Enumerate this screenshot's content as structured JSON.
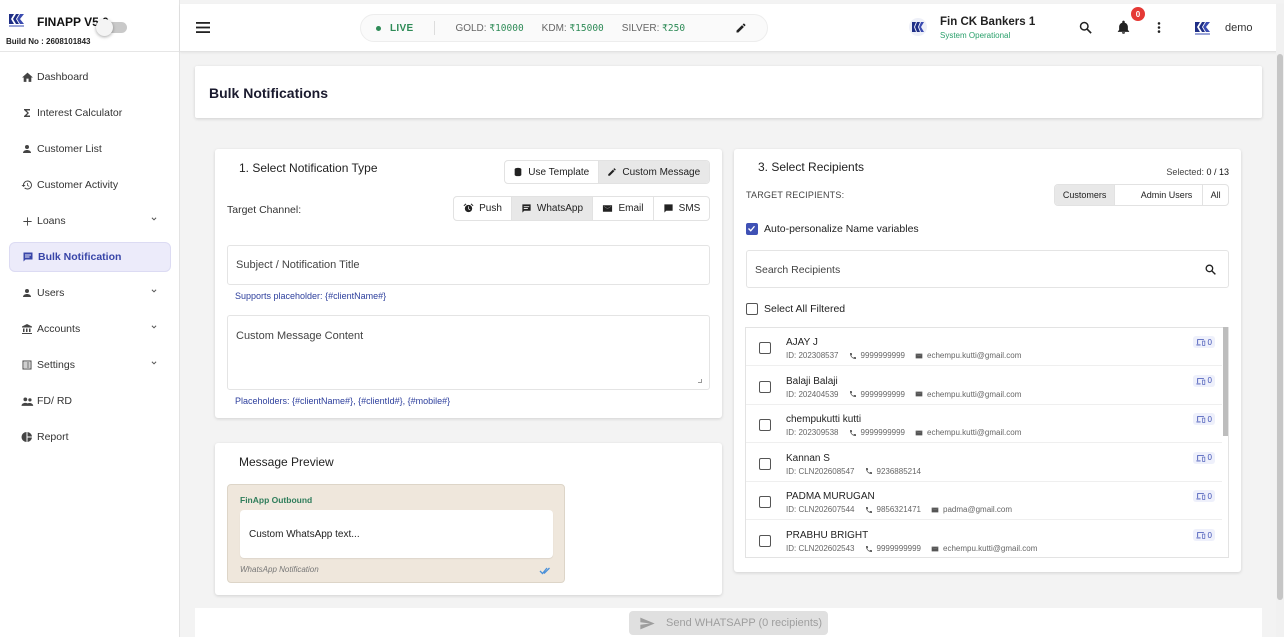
{
  "sidebar": {
    "app_name": "FINAPP V5.0",
    "build": "Build No : 2608101843",
    "items": [
      {
        "label": "Dashboard",
        "icon": "home-icon"
      },
      {
        "label": "Interest Calculator",
        "icon": "sigma-icon"
      },
      {
        "label": "Customer List",
        "icon": "person-icon"
      },
      {
        "label": "Customer Activity",
        "icon": "history-icon"
      },
      {
        "label": "Loans",
        "icon": "plus-icon"
      },
      {
        "label": "Bulk Notification",
        "icon": "message-icon"
      },
      {
        "label": "Users",
        "icon": "person-icon"
      },
      {
        "label": "Accounts",
        "icon": "bank-icon"
      },
      {
        "label": "Settings",
        "icon": "list-icon"
      },
      {
        "label": "FD/ RD",
        "icon": "group-icon"
      },
      {
        "label": "Report",
        "icon": "pie-chart-icon"
      }
    ],
    "active_index": 5
  },
  "topbar": {
    "live_label": "LIVE",
    "rates": [
      {
        "name": "GOLD:",
        "value": "₹10000"
      },
      {
        "name": "KDM:",
        "value": "₹15000"
      },
      {
        "name": "SILVER:",
        "value": "₹250"
      }
    ],
    "company_name": "Fin CK Bankers 1",
    "company_status": "System Operational",
    "notification_count": "0",
    "user_name": "demo"
  },
  "page": {
    "title": "Bulk Notifications"
  },
  "notification_type": {
    "title": "1. Select Notification Type",
    "mode_options": [
      "Use Template",
      "Custom Message"
    ],
    "mode_selected": "Custom Message",
    "channel_label": "Target Channel:",
    "channels": [
      "Push",
      "WhatsApp",
      "Email",
      "SMS"
    ],
    "channel_selected": "WhatsApp",
    "subject_placeholder": "Subject / Notification Title",
    "subject_hint": "Supports placeholder: {#clientName#}",
    "message_placeholder": "Custom Message Content",
    "message_hint": "Placeholders: {#clientName#}, {#clientId#}, {#mobile#}"
  },
  "preview": {
    "title": "Message Preview",
    "sender": "FinApp Outbound",
    "text": "Custom WhatsApp text...",
    "footer": "WhatsApp Notification"
  },
  "recipients": {
    "title": "3. Select Recipients",
    "selected_label": "Selected:",
    "selected_value": "0 / 13",
    "target_label": "TARGET RECIPIENTS:",
    "target_options": [
      "Customers",
      "Admin Users",
      "All"
    ],
    "target_selected": "Customers",
    "auto_personalize_label": "Auto-personalize Name variables",
    "auto_personalize": true,
    "search_placeholder": "Search Recipients",
    "select_all_label": "Select All Filtered",
    "list": [
      {
        "name": "AJAY J",
        "id": "ID: 202308537",
        "phone": "9999999999",
        "email": "echempu.kutti@gmail.com",
        "count": "0"
      },
      {
        "name": "Balaji Balaji",
        "id": "ID: 202404539",
        "phone": "9999999999",
        "email": "echempu.kutti@gmail.com",
        "count": "0"
      },
      {
        "name": "chempukutti kutti",
        "id": "ID: 202309538",
        "phone": "9999999999",
        "email": "echempu.kutti@gmail.com",
        "count": "0"
      },
      {
        "name": "Kannan S",
        "id": "ID: CLN202608547",
        "phone": "9236885214",
        "email": "",
        "count": "0"
      },
      {
        "name": "PADMA MURUGAN",
        "id": "ID: CLN202607544",
        "phone": "9856321471",
        "email": "padma@gmail.com",
        "count": "0"
      },
      {
        "name": "PRABHU BRIGHT",
        "id": "ID: CLN202602543",
        "phone": "9999999999",
        "email": "echempu.kutti@gmail.com",
        "count": "0"
      }
    ]
  },
  "send": {
    "label": "Send WHATSAPP (0 recipients)"
  },
  "colors": {
    "accent": "#3f51b5",
    "live_green": "#2e8b57",
    "active_nav_bg": "#ecebfa",
    "badge_red": "#e53935"
  }
}
